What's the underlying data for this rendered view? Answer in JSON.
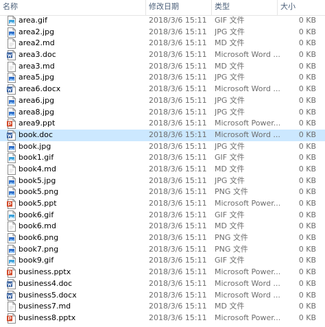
{
  "header": {
    "name": "名称",
    "date": "修改日期",
    "type": "类型",
    "size": "大小"
  },
  "colors": {
    "selected_row": "#cce8ff",
    "header_text": "#4c607a",
    "image_icon": "#2f6fc9",
    "word_icon": "#2b579a",
    "ppt_icon": "#d24726",
    "gif_icon": "#3aa0d9"
  },
  "files": [
    {
      "name": "area.gif",
      "date": "2018/3/6 15:11",
      "type": "GIF 文件",
      "size": "0 KB",
      "icon": "gif-file-icon"
    },
    {
      "name": "area2.jpg",
      "date": "2018/3/6 15:11",
      "type": "JPG 文件",
      "size": "0 KB",
      "icon": "image-file-icon"
    },
    {
      "name": "area2.md",
      "date": "2018/3/6 15:11",
      "type": "MD 文件",
      "size": "0 KB",
      "icon": "text-file-icon"
    },
    {
      "name": "area3.doc",
      "date": "2018/3/6 15:11",
      "type": "Microsoft Word ...",
      "size": "0 KB",
      "icon": "word-file-icon"
    },
    {
      "name": "area3.md",
      "date": "2018/3/6 15:11",
      "type": "MD 文件",
      "size": "0 KB",
      "icon": "text-file-icon"
    },
    {
      "name": "area5.jpg",
      "date": "2018/3/6 15:11",
      "type": "JPG 文件",
      "size": "0 KB",
      "icon": "image-file-icon"
    },
    {
      "name": "area6.docx",
      "date": "2018/3/6 15:11",
      "type": "Microsoft Word ...",
      "size": "0 KB",
      "icon": "word-file-icon"
    },
    {
      "name": "area6.jpg",
      "date": "2018/3/6 15:11",
      "type": "JPG 文件",
      "size": "0 KB",
      "icon": "image-file-icon"
    },
    {
      "name": "area8.jpg",
      "date": "2018/3/6 15:11",
      "type": "JPG 文件",
      "size": "0 KB",
      "icon": "image-file-icon"
    },
    {
      "name": "area9.ppt",
      "date": "2018/3/6 15:11",
      "type": "Microsoft Power...",
      "size": "0 KB",
      "icon": "powerpoint-file-icon"
    },
    {
      "name": "book.doc",
      "date": "2018/3/6 15:11",
      "type": "Microsoft Word ...",
      "size": "0 KB",
      "icon": "word-file-icon",
      "selected": true
    },
    {
      "name": "book.jpg",
      "date": "2018/3/6 15:11",
      "type": "JPG 文件",
      "size": "0 KB",
      "icon": "image-file-icon"
    },
    {
      "name": "book1.gif",
      "date": "2018/3/6 15:11",
      "type": "GIF 文件",
      "size": "0 KB",
      "icon": "gif-file-icon"
    },
    {
      "name": "book4.md",
      "date": "2018/3/6 15:11",
      "type": "MD 文件",
      "size": "0 KB",
      "icon": "text-file-icon"
    },
    {
      "name": "book5.jpg",
      "date": "2018/3/6 15:11",
      "type": "JPG 文件",
      "size": "0 KB",
      "icon": "image-file-icon"
    },
    {
      "name": "book5.png",
      "date": "2018/3/6 15:11",
      "type": "PNG 文件",
      "size": "0 KB",
      "icon": "image-file-icon"
    },
    {
      "name": "book5.ppt",
      "date": "2018/3/6 15:11",
      "type": "Microsoft Power...",
      "size": "0 KB",
      "icon": "powerpoint-file-icon"
    },
    {
      "name": "book6.gif",
      "date": "2018/3/6 15:11",
      "type": "GIF 文件",
      "size": "0 KB",
      "icon": "gif-file-icon"
    },
    {
      "name": "book6.md",
      "date": "2018/3/6 15:11",
      "type": "MD 文件",
      "size": "0 KB",
      "icon": "text-file-icon"
    },
    {
      "name": "book6.png",
      "date": "2018/3/6 15:11",
      "type": "PNG 文件",
      "size": "0 KB",
      "icon": "image-file-icon"
    },
    {
      "name": "book7.png",
      "date": "2018/3/6 15:11",
      "type": "PNG 文件",
      "size": "0 KB",
      "icon": "image-file-icon"
    },
    {
      "name": "book9.gif",
      "date": "2018/3/6 15:11",
      "type": "GIF 文件",
      "size": "0 KB",
      "icon": "gif-file-icon"
    },
    {
      "name": "business.pptx",
      "date": "2018/3/6 15:11",
      "type": "Microsoft Power...",
      "size": "0 KB",
      "icon": "powerpoint-file-icon"
    },
    {
      "name": "business4.doc",
      "date": "2018/3/6 15:11",
      "type": "Microsoft Word ...",
      "size": "0 KB",
      "icon": "word-file-icon"
    },
    {
      "name": "business5.docx",
      "date": "2018/3/6 15:11",
      "type": "Microsoft Word ...",
      "size": "0 KB",
      "icon": "word-file-icon"
    },
    {
      "name": "business7.md",
      "date": "2018/3/6 15:11",
      "type": "MD 文件",
      "size": "0 KB",
      "icon": "text-file-icon"
    },
    {
      "name": "business8.pptx",
      "date": "2018/3/6 15:11",
      "type": "Microsoft Power...",
      "size": "0 KB",
      "icon": "powerpoint-file-icon"
    }
  ]
}
